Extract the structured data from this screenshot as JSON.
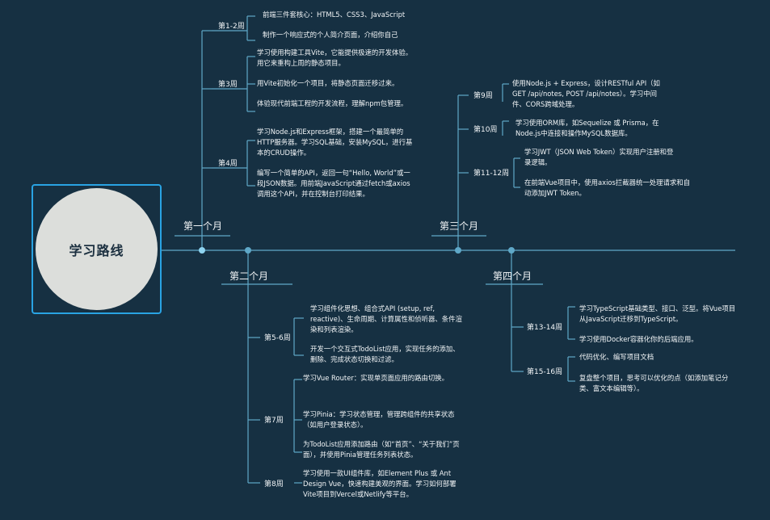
{
  "root": {
    "title": "学习路线"
  },
  "months": [
    {
      "label": "第一个月",
      "weeks": [
        {
          "label": "第1-2周",
          "items": [
            "前端三件套核心：HTML5、CSS3、JavaScript",
            "制作一个响应式的个人简介页面，介绍你自己"
          ]
        },
        {
          "label": "第3周",
          "items": [
            "学习使用构建工具Vite，它能提供极速的开发体验。用它来重构上周的静态项目。",
            "用Vite初始化一个项目，将静态页面迁移过来。",
            "体验现代前端工程的开发流程，理解npm包管理。"
          ]
        },
        {
          "label": "第4周",
          "items": [
            "学习Node.js和Express框架，搭建一个最简单的HTTP服务器。学习SQL基础，安装MySQL，进行基本的CRUD操作。",
            "编写一个简单的API，返回一句“Hello, World”或一段JSON数据。用前端JavaScript通过fetch或axios调用这个API，并在控制台打印结果。"
          ]
        }
      ]
    },
    {
      "label": "第二个月",
      "weeks": [
        {
          "label": "第5-6周",
          "items": [
            "学习组件化思想、组合式API (setup, ref, reactive)、生命周期、计算属性和侦听器、条件渲染和列表渲染。",
            "开发一个交互式TodoList应用，实现任务的添加、删除、完成状态切换和过滤。"
          ]
        },
        {
          "label": "第7周",
          "items": [
            "学习Vue Router：实现单页面应用的路由切换。",
            "学习Pinia：学习状态管理，管理跨组件的共享状态（如用户登录状态）。",
            "为TodoList应用添加路由（如“首页”、“关于我们”页面），并使用Pinia管理任务列表状态。"
          ]
        },
        {
          "label": "第8周",
          "items": [
            "学习使用一款UI组件库，如Element Plus 或 Ant Design Vue，快速构建美观的界面。学习如何部署Vite项目到Vercel或Netlify等平台。"
          ]
        }
      ]
    },
    {
      "label": "第三个月",
      "weeks": [
        {
          "label": "第9周",
          "items": [
            "使用Node.js + Express，设计RESTful API（如 GET /api/notes, POST /api/notes）。学习中间件、CORS跨域处理。"
          ]
        },
        {
          "label": "第10周",
          "items": [
            "学习使用ORM库，如Sequelize 或 Prisma，在Node.js中连接和操作MySQL数据库。"
          ]
        },
        {
          "label": "第11-12周",
          "items": [
            "学习JWT（JSON Web Token）实现用户注册和登录逻辑。",
            "在前端Vue项目中，使用axios拦截器统一处理请求和自动添加JWT Token。"
          ]
        }
      ]
    },
    {
      "label": "第四个月",
      "weeks": [
        {
          "label": "第13-14周",
          "items": [
            "学习TypeScript基础类型、接口、泛型。将Vue项目从JavaScript迁移到TypeScript。",
            "学习使用Docker容器化你的后端应用。"
          ]
        },
        {
          "label": "第15-16周",
          "items": [
            "代码优化、编写项目文档",
            "复盘整个项目，思考可以优化的点（如添加笔记分类、富文本编辑等）。"
          ]
        }
      ]
    }
  ]
}
